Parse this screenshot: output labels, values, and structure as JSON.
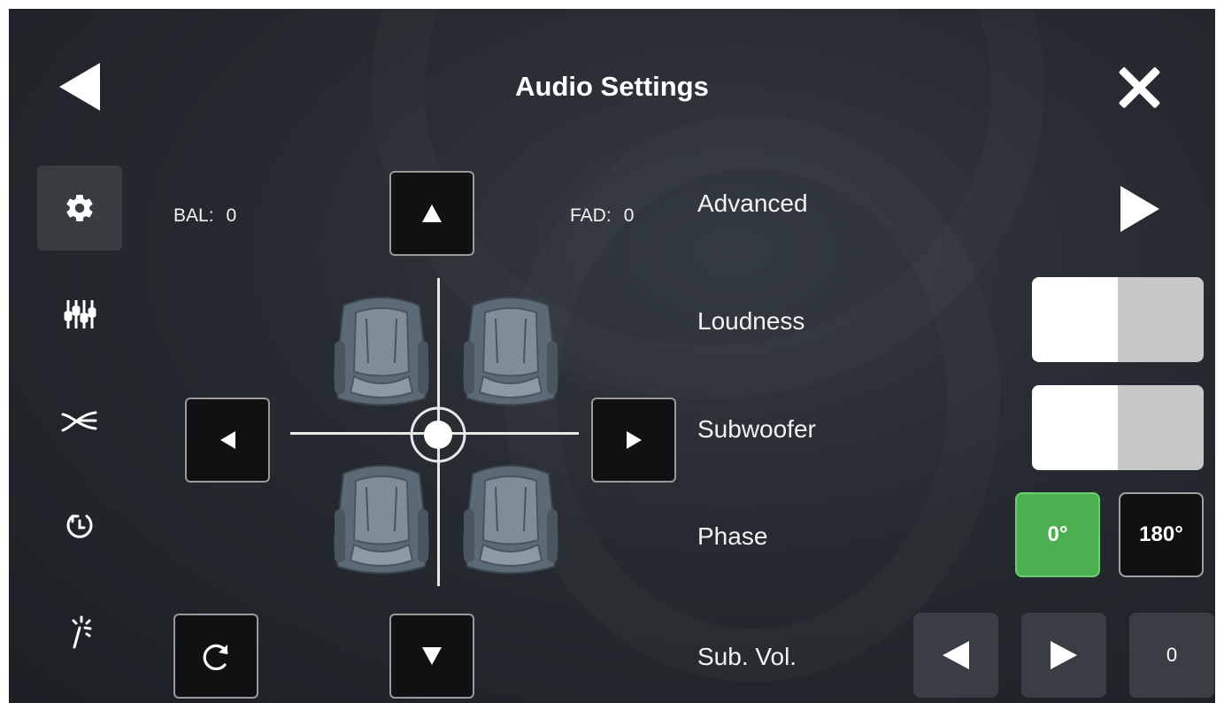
{
  "header": {
    "title": "Audio Settings",
    "back_icon": "back-arrow-icon",
    "close_icon": "close-icon"
  },
  "sidebar": {
    "items": [
      {
        "icon": "gear-icon",
        "active": true
      },
      {
        "icon": "equalizer-sliders-icon",
        "active": false
      },
      {
        "icon": "crossover-icon",
        "active": false
      },
      {
        "icon": "history-reset-icon",
        "active": false
      },
      {
        "icon": "magic-wand-icon",
        "active": false
      }
    ]
  },
  "balance": {
    "label": "BAL:",
    "value": "0"
  },
  "fader": {
    "label": "FAD:",
    "value": "0"
  },
  "settings": {
    "advanced_label": "Advanced",
    "loudness_label": "Loudness",
    "loudness_on": false,
    "subwoofer_label": "Subwoofer",
    "subwoofer_on": false,
    "phase_label": "Phase",
    "phase_options": [
      "0°",
      "180°"
    ],
    "phase_selected": "0°",
    "sub_vol_label": "Sub. Vol.",
    "sub_vol_value": "0"
  },
  "colors": {
    "accent_green": "#4caf50",
    "background": "#262b31"
  }
}
